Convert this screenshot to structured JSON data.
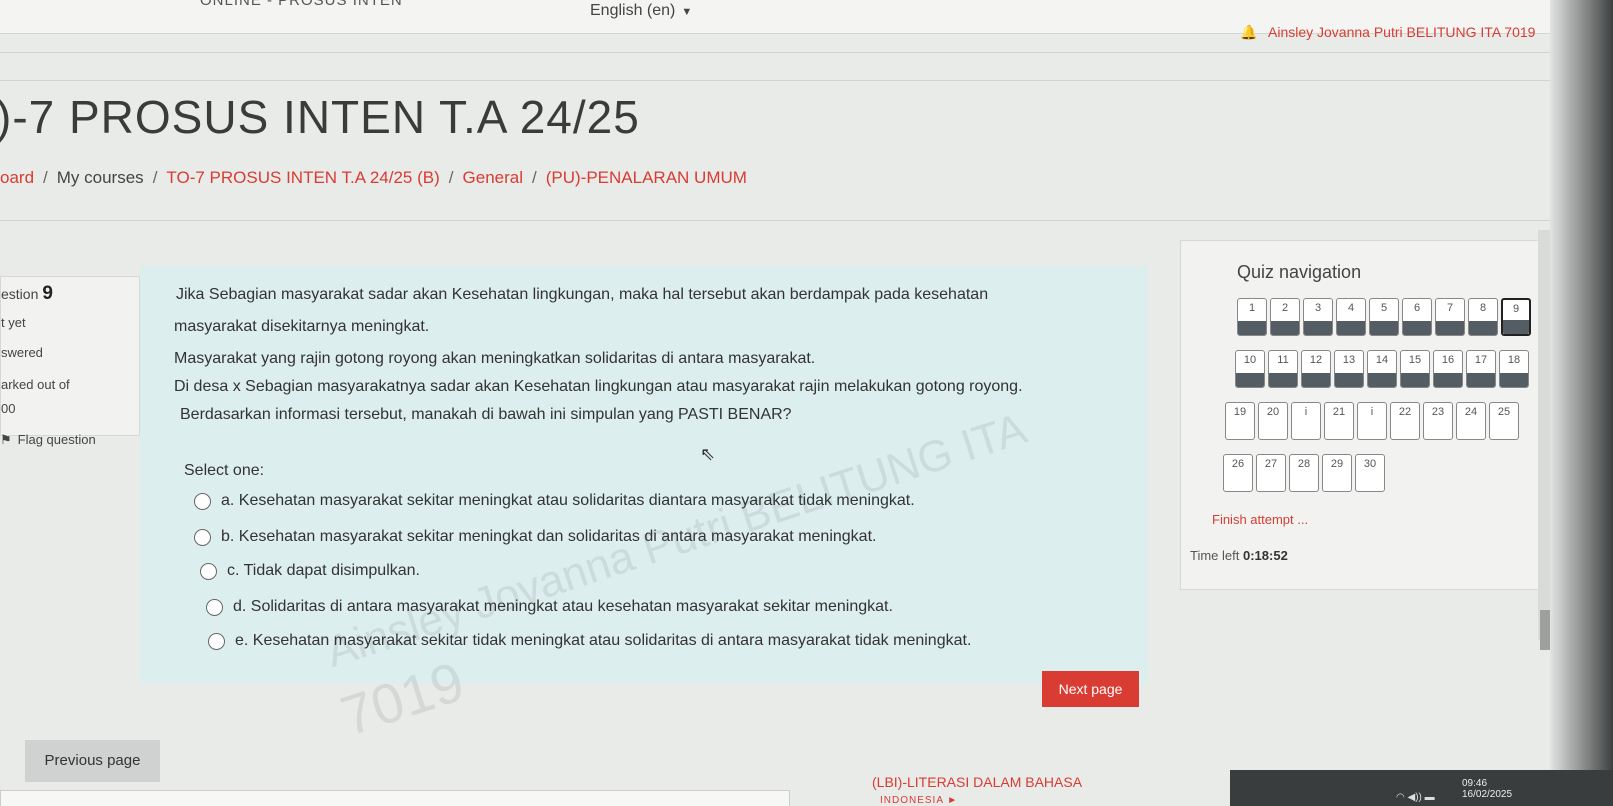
{
  "top_bar": {
    "course_fragment": "ONLINE - PROSUS INTEN",
    "language": "English (en)",
    "username": "Ainsley Jovanna Putri BELITUNG ITA 7019"
  },
  "page": {
    "title": ")-7 PROSUS INTEN T.A 24/25"
  },
  "breadcrumb": [
    "oard",
    "My courses",
    "TO-7 PROSUS INTEN T.A 24/25 (B)",
    "General",
    "(PU)-PENALARAN UMUM"
  ],
  "question_info": {
    "label": "estion",
    "number": "9",
    "status": "t yet",
    "status2": "swered",
    "marked_out_of": "arked out of",
    "marks": "00",
    "flag_label": "Flag question"
  },
  "question": {
    "lines": [
      "Jika Sebagian masyarakat sadar akan Kesehatan lingkungan, maka hal tersebut akan berdampak pada kesehatan",
      "masyarakat disekitarnya meningkat.",
      "Masyarakat yang rajin gotong royong akan meningkatkan solidaritas di antara masyarakat.",
      "Di desa x Sebagian masyarakatnya sadar akan Kesehatan lingkungan atau masyarakat rajin melakukan gotong royong.",
      "Berdasarkan informasi tersebut, manakah di bawah ini simpulan yang PASTI BENAR?"
    ],
    "select_label": "Select one:",
    "options": [
      "a. Kesehatan masyarakat sekitar meningkat atau solidaritas diantara masyarakat tidak meningkat.",
      "b. Kesehatan masyarakat sekitar meningkat dan solidaritas di antara masyarakat meningkat.",
      "c. Tidak dapat disimpulkan.",
      "d. Solidaritas di antara masyarakat meningkat atau kesehatan masyarakat sekitar meningkat.",
      "e. Kesehatan masyarakat sekitar tidak meningkat atau solidaritas di antara masyarakat tidak meningkat."
    ],
    "watermark_1": "Ainsley Jovanna Putri BELITUNG ITA",
    "watermark_2": "7019"
  },
  "quiz_nav": {
    "title": "Quiz navigation",
    "rows": [
      [
        "1",
        "2",
        "3",
        "4",
        "5",
        "6",
        "7",
        "8",
        "9"
      ],
      [
        "10",
        "11",
        "12",
        "13",
        "14",
        "15",
        "16",
        "17",
        "18"
      ],
      [
        "19",
        "20",
        "i",
        "21",
        "i",
        "22",
        "23",
        "24",
        "25"
      ],
      [
        "26",
        "27",
        "28",
        "29",
        "30"
      ]
    ],
    "current": "9",
    "finish_label": "Finish attempt ...",
    "time_label": "Time left",
    "time_value": "0:18:52"
  },
  "buttons": {
    "next": "Next page",
    "previous": "Previous page"
  },
  "bottom": {
    "link": "(LBI)-LITERASI DALAM BAHASA",
    "link2": "INDONESIA ►"
  },
  "system": {
    "time": "09:46",
    "date": "16/02/2025"
  }
}
